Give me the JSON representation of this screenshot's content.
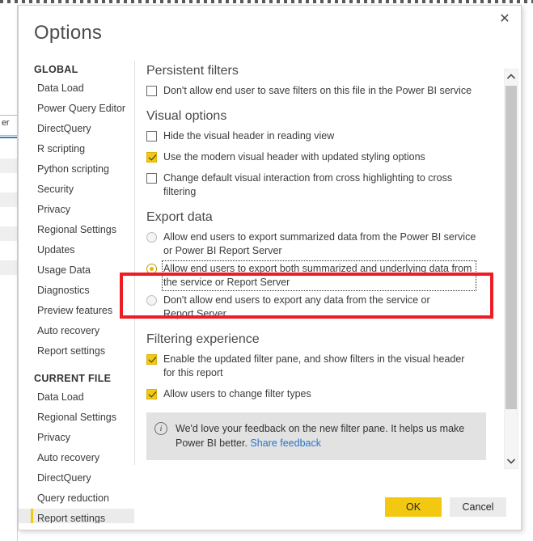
{
  "dialog": {
    "title": "Options",
    "close_icon": "close-icon"
  },
  "sidebar": {
    "groups": [
      {
        "label": "GLOBAL",
        "items": [
          {
            "label": "Data Load"
          },
          {
            "label": "Power Query Editor"
          },
          {
            "label": "DirectQuery"
          },
          {
            "label": "R scripting"
          },
          {
            "label": "Python scripting"
          },
          {
            "label": "Security"
          },
          {
            "label": "Privacy"
          },
          {
            "label": "Regional Settings"
          },
          {
            "label": "Updates"
          },
          {
            "label": "Usage Data"
          },
          {
            "label": "Diagnostics"
          },
          {
            "label": "Preview features"
          },
          {
            "label": "Auto recovery"
          },
          {
            "label": "Report settings"
          }
        ]
      },
      {
        "label": "CURRENT FILE",
        "items": [
          {
            "label": "Data Load"
          },
          {
            "label": "Regional Settings"
          },
          {
            "label": "Privacy"
          },
          {
            "label": "Auto recovery"
          },
          {
            "label": "DirectQuery"
          },
          {
            "label": "Query reduction"
          },
          {
            "label": "Report settings"
          }
        ]
      }
    ],
    "selected": "Report settings"
  },
  "content": {
    "sections": [
      {
        "heading": "Persistent filters",
        "options": [
          {
            "type": "checkbox",
            "checked": false,
            "label": "Don't allow end user to save filters on this file in the Power BI service"
          }
        ]
      },
      {
        "heading": "Visual options",
        "options": [
          {
            "type": "checkbox",
            "checked": false,
            "label": "Hide the visual header in reading view"
          },
          {
            "type": "checkbox",
            "checked": true,
            "label": "Use the modern visual header with updated styling options"
          },
          {
            "type": "checkbox",
            "checked": false,
            "label": "Change default visual interaction from cross highlighting to cross filtering"
          }
        ]
      },
      {
        "heading": "Export data",
        "options": [
          {
            "type": "radio",
            "checked": false,
            "focused": false,
            "label": "Allow end users to export summarized data from the Power BI service or Power BI Report Server"
          },
          {
            "type": "radio",
            "checked": true,
            "focused": true,
            "label": "Allow end users to export both summarized and underlying data from the service or Report Server"
          },
          {
            "type": "radio",
            "checked": false,
            "focused": false,
            "label": "Don't allow end users to export any data from the service or Report Server"
          }
        ]
      },
      {
        "heading": "Filtering experience",
        "options": [
          {
            "type": "checkbox",
            "checked": true,
            "label": "Enable the updated filter pane, and show filters in the visual header for this report"
          },
          {
            "type": "checkbox",
            "checked": true,
            "label": "Allow users to change filter types"
          }
        ]
      }
    ],
    "banner": {
      "icon": "info-icon",
      "text": "We'd love your feedback on the new filter pane. It helps us make Power BI better.",
      "link_label": "Share feedback"
    }
  },
  "scrollbar": {
    "up_icon": "chevron-up-icon",
    "down_icon": "chevron-down-icon"
  },
  "footer": {
    "ok_label": "OK",
    "cancel_label": "Cancel"
  },
  "background": {
    "sliver_text": "er"
  },
  "annotation": {
    "color": "#ee1c25"
  },
  "colors": {
    "accent": "#f2c811",
    "link": "#2a74c9",
    "banner_bg": "#e2e2e2",
    "selected_bg": "#ebebeb"
  }
}
